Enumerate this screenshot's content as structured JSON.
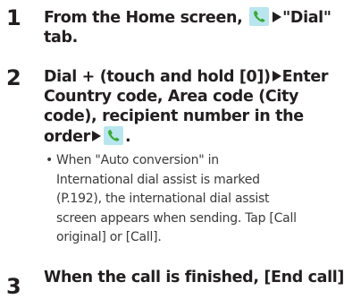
{
  "steps": [
    {
      "number": "1",
      "lines": [
        {
          "before": "From the Home screen, ",
          "icon": "phone-icon",
          "after": "\"Dial\""
        },
        {
          "text": "tab."
        }
      ]
    },
    {
      "number": "2",
      "lines": [
        {
          "before": "Dial + (touch and hold [0])",
          "after": "Enter"
        },
        {
          "text": "Country code, Area code (City"
        },
        {
          "text": "code), recipient number in the"
        },
        {
          "before": "order",
          "icon": "phone-icon",
          "after": "."
        }
      ],
      "note": {
        "bullet": "•",
        "lines": [
          "When \"Auto conversion\" in",
          "International dial assist is marked",
          "(P.192), the international dial assist",
          "screen appears when sending. Tap [Call",
          "original] or [Call]."
        ]
      }
    },
    {
      "number": "3",
      "lines": [
        {
          "text": "When the call is finished, [End call]."
        }
      ]
    }
  ],
  "colors": {
    "text": "#231f20",
    "note_text": "#3a3a3a",
    "icon_bg": "#b9e6ee",
    "icon_phone": "#3aaa35"
  },
  "icons": {
    "arrow": "black-right-triangle",
    "phone": "green-phone-handset"
  }
}
